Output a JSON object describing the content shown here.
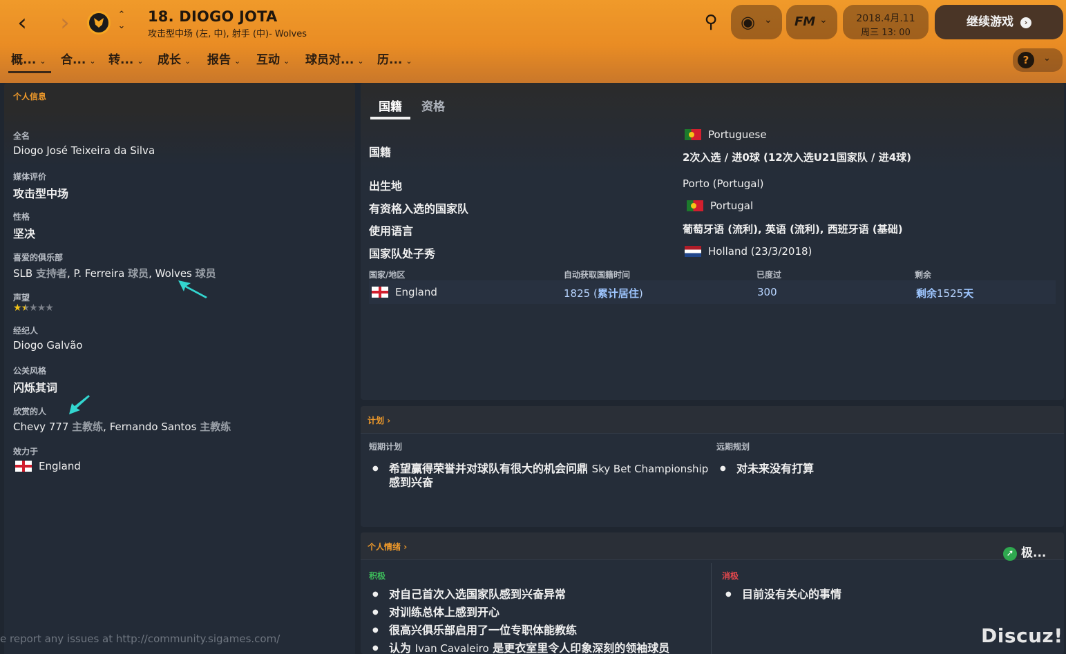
{
  "header": {
    "title": "18. DIOGO JOTA",
    "subtitle": "攻击型中场 (左, 中), 射手 (中)- Wolves",
    "date_line1": "2018.4月.11",
    "date_line2": "周三 13: 00",
    "continue_label": "继续游戏",
    "fm_label": "FM",
    "icons": [
      "back-arrow-icon",
      "forward-arrow-icon",
      "club-crest-icon",
      "search-icon",
      "globe-icon",
      "help-icon"
    ]
  },
  "tabs": [
    {
      "label": "概..."
    },
    {
      "label": "合..."
    },
    {
      "label": "转..."
    },
    {
      "label": "成长"
    },
    {
      "label": "报告"
    },
    {
      "label": "互动"
    },
    {
      "label": "球员对..."
    },
    {
      "label": "历..."
    }
  ],
  "personal": {
    "heading": "个人信息",
    "full_name_label": "全名",
    "full_name": "Diogo José Teixeira da Silva",
    "media_label": "媒体评价",
    "media": "攻击型中场",
    "personality_label": "性格",
    "personality": "坚决",
    "fav_clubs_label": "喜爱的俱乐部",
    "fav_club_1": "SLB",
    "fav_club_1_role": "支持者",
    "fav_club_2": "P. Ferreira",
    "fav_club_2_role": "球员",
    "fav_club_3": "Wolves",
    "fav_club_3_role": "球员",
    "reputation_label": "声望",
    "reputation_stars": 1.5,
    "agent_label": "经纪人",
    "agent": "Diogo Galvão",
    "pr_label": "公关风格",
    "pr": "闪烁其词",
    "admired_label": "欣赏的人",
    "admired_1": "Chevy 777",
    "admired_1_role": "主教练",
    "admired_2": "Fernando Santos",
    "admired_2_role": "主教练",
    "plays_for_label": "效力于",
    "plays_for": "England"
  },
  "nationality": {
    "tab_active": "国籍",
    "tab_other": "资格",
    "nat_label": "国籍",
    "nat_value": "Portuguese",
    "caps": "2次入选 / 进0球 (12次入选U21国家队 / 进4球)",
    "birthplace_label": "出生地",
    "birthplace": "Porto (Portugal)",
    "eligible_label": "有资格入选的国家队",
    "eligible": "Portugal",
    "language_label": "使用语言",
    "language": "葡萄牙语 (流利), 英语 (流利), 西班牙语 (基础)",
    "debut_label": "国家队处子秀",
    "debut": "Holland (23/3/2018)",
    "table_headers": [
      "国家/地区",
      "自动获取国籍时间",
      "已度过",
      "剩余"
    ],
    "table_row": {
      "country": "England",
      "auto_time": "1825",
      "auto_note": "累计居住",
      "spent": "300",
      "remaining_prefix": "剩余",
      "remaining": "1525",
      "remaining_suffix": "天"
    }
  },
  "plans": {
    "heading": "计划",
    "short_label": "短期计划",
    "short_text_a": "希望赢得荣誉并对球队有很大的机会问鼎",
    "short_text_b": "Sky Bet Championship",
    "short_text_c": "感到兴奋",
    "long_label": "远期规划",
    "long_text": "对未来没有打算"
  },
  "mood": {
    "heading": "个人情绪",
    "status": "极...",
    "positive_label": "积极",
    "positive": [
      "对自己首次入选国家队感到兴奋异常",
      "对训练总体上感到开心",
      "很高兴俱乐部启用了一位专职体能教练"
    ],
    "positive_4a": "认为",
    "positive_4b": "Ivan Cavaleiro",
    "positive_4c": "是更衣室里令人印象深刻的领袖球员",
    "negative_label": "消极",
    "negative": [
      "目前没有关心的事情"
    ]
  },
  "footer_note": "e report any issues at http://community.sigames.com/",
  "watermark": "Discuz!",
  "colors": {
    "accent": "#f09a2a",
    "panel": "#252d39",
    "positive": "#3dbb5a",
    "negative": "#e5484d"
  }
}
